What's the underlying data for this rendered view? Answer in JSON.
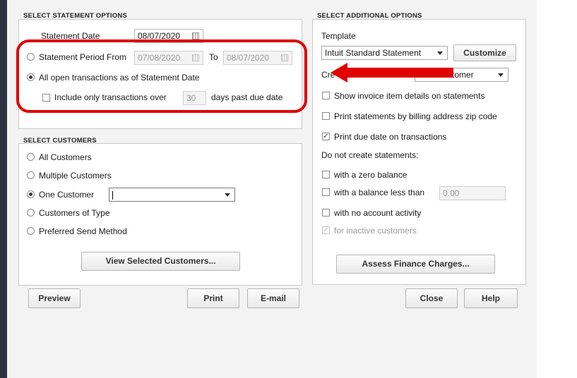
{
  "statement_options": {
    "title": "SELECT STATEMENT OPTIONS",
    "statement_date_label": "Statement Date",
    "statement_date": "08/07/2020",
    "period_from_label": "Statement Period From",
    "period_from": "07/08/2020",
    "to_label": "To",
    "period_to": "08/07/2020",
    "all_open_label": "All open transactions as of Statement Date",
    "include_only_label": "Include only transactions over",
    "days_value": "30",
    "days_label": "days past due date"
  },
  "customers": {
    "title": "SELECT CUSTOMERS",
    "all": "All Customers",
    "multiple": "Multiple Customers",
    "one": "One Customer",
    "one_value": "",
    "of_type": "Customers of Type",
    "preferred": "Preferred Send Method",
    "view_selected_button": "View Selected Customers..."
  },
  "additional_options": {
    "title": "SELECT ADDITIONAL OPTIONS",
    "template_label": "Template",
    "template_value": "Intuit Standard Statement",
    "customize_button": "Customize",
    "create_label": "Cre",
    "create_value": "tomer",
    "show_invoice_details": "Show invoice item details on statements",
    "print_by_zip": "Print statements by billing address zip code",
    "print_due_date": "Print due date on transactions",
    "do_not_create_label": "Do not create statements:",
    "zero_balance": "with a zero balance",
    "balance_less_than": "with a balance less than",
    "balance_value": "0.00",
    "no_activity": "with no account activity",
    "inactive_customers": "for inactive customers",
    "assess_button": "Assess Finance Charges..."
  },
  "buttons": {
    "preview": "Preview",
    "print": "Print",
    "email": "E-mail",
    "close": "Close",
    "help": "Help"
  },
  "annotation_color": "#e00000"
}
